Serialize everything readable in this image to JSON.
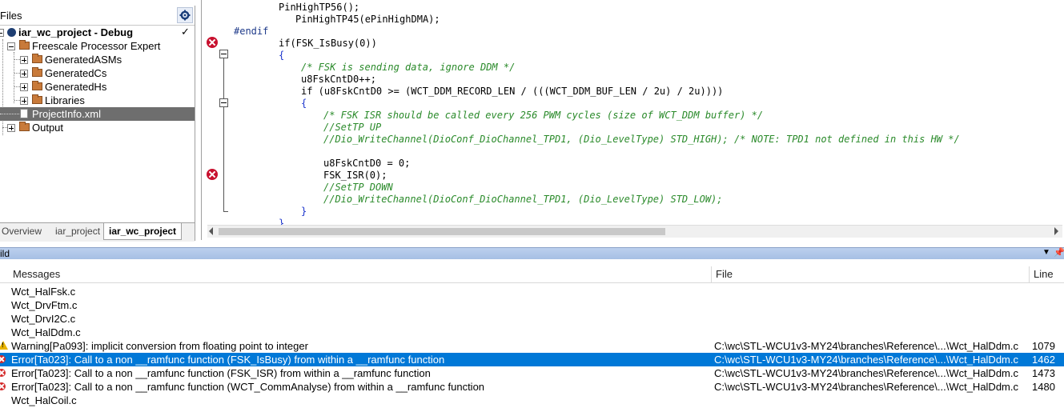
{
  "workspace": {
    "title": "Files",
    "project": "iar_wc_project - Debug",
    "tree": [
      {
        "label": "Freescale Processor Expert"
      },
      {
        "label": "GeneratedASMs"
      },
      {
        "label": "GeneratedCs"
      },
      {
        "label": "GeneratedHs"
      },
      {
        "label": "Libraries"
      },
      {
        "label": "ProjectInfo.xml"
      },
      {
        "label": "Output"
      }
    ],
    "tabs": [
      "Overview",
      "iar_project",
      "iar_wc_project"
    ],
    "colors": {
      "selected_row": "#6e6e6e"
    }
  },
  "editor": {
    "lines": [
      "PinHighTP56();",
      "PinHighTP45(ePinHighDMA);",
      "#endif",
      "if(FSK_IsBusy(0))",
      "{",
      "/* FSK is sending data, ignore DDM */",
      "u8FskCntD0++;",
      "if (u8FskCntD0 >= (WCT_DDM_RECORD_LEN / (((WCT_DDM_BUF_LEN / 2u) / 2u))))",
      "{",
      "/* FSK ISR should be called every 256 PWM cycles (size of WCT_DDM buffer) */",
      "//SetTP UP",
      "//Dio_WriteChannel(DioConf_DioChannel_TPD1, (Dio_LevelType) STD_HIGH); /* NOTE: TPD1 not defined in this HW */",
      "u8FskCntD0 = 0;",
      "FSK_ISR(0);",
      "//SetTP DOWN",
      "//Dio_WriteChannel(DioConf_DioChannel_TPD1, (Dio_LevelType) STD_LOW);",
      "}",
      "}"
    ]
  },
  "build": {
    "title": "ild",
    "columns": {
      "messages": "Messages",
      "file": "File",
      "line": "Line"
    },
    "rows": [
      {
        "message": "Wct_HalFsk.c",
        "file": "",
        "line": "",
        "icon": ""
      },
      {
        "message": "Wct_DrvFtm.c",
        "file": "",
        "line": "",
        "icon": ""
      },
      {
        "message": "Wct_DrvI2C.c",
        "file": "",
        "line": "",
        "icon": ""
      },
      {
        "message": "Wct_HalDdm.c",
        "file": "",
        "line": "",
        "icon": ""
      },
      {
        "message": "Warning[Pa093]: implicit conversion from floating point to integer",
        "file": "C:\\wc\\STL-WCU1v3-MY24\\branches\\Reference\\...\\Wct_HalDdm.c",
        "line": "1079",
        "icon": "warning-icon"
      },
      {
        "message": "Error[Ta023]: Call to a non __ramfunc function (FSK_IsBusy) from within a __ramfunc function",
        "file": "C:\\wc\\STL-WCU1v3-MY24\\branches\\Reference\\...\\Wct_HalDdm.c",
        "line": "1462",
        "icon": "error-icon",
        "selected": true
      },
      {
        "message": "Error[Ta023]: Call to a non __ramfunc function (FSK_ISR) from within a __ramfunc function",
        "file": "C:\\wc\\STL-WCU1v3-MY24\\branches\\Reference\\...\\Wct_HalDdm.c",
        "line": "1473",
        "icon": "error-icon"
      },
      {
        "message": "Error[Ta023]: Call to a non __ramfunc function (WCT_CommAnalyse) from within a __ramfunc function",
        "file": "C:\\wc\\STL-WCU1v3-MY24\\branches\\Reference\\...\\Wct_HalDdm.c",
        "line": "1480",
        "icon": "error-icon"
      },
      {
        "message": "Wct_HalCoil.c",
        "file": "",
        "line": "",
        "icon": ""
      }
    ],
    "colors": {
      "selection": "#0078d7",
      "error": "#d42a2a",
      "warning": "#e8b400"
    }
  }
}
